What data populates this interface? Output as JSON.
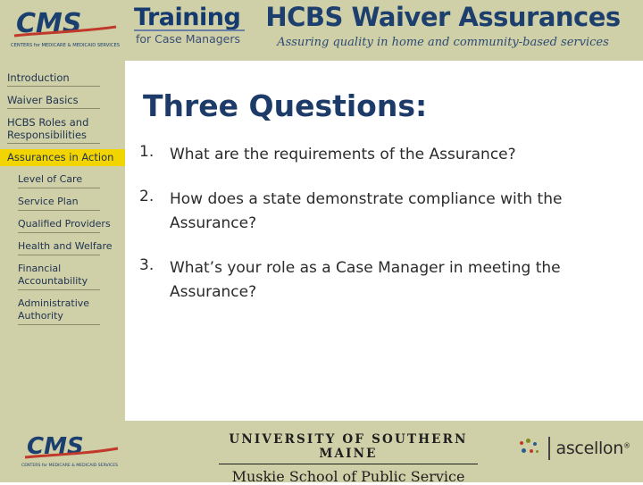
{
  "header": {
    "logo_top": "cms-logo",
    "logo_top_caption": "CENTERS for MEDICARE & MEDICAID SERVICES",
    "logo_text": "CMS",
    "training_word": "Training",
    "training_sub": "for Case Managers",
    "title": "HCBS Waiver Assurances",
    "subtitle": "Assuring quality in home and community-based services"
  },
  "sidebar": {
    "items": [
      {
        "label": "Introduction",
        "level": "top",
        "active": false
      },
      {
        "label": "Waiver Basics",
        "level": "top",
        "active": false
      },
      {
        "label": "HCBS Roles and Responsibilities",
        "level": "top",
        "active": false
      },
      {
        "label": "Assurances in Action",
        "level": "top",
        "active": true
      },
      {
        "label": "Level of Care",
        "level": "sub",
        "active": false
      },
      {
        "label": "Service Plan",
        "level": "sub",
        "active": false
      },
      {
        "label": "Qualified Providers",
        "level": "sub",
        "active": false
      },
      {
        "label": "Health and Welfare",
        "level": "sub",
        "active": false
      },
      {
        "label": "Financial Accountability",
        "level": "sub",
        "active": false
      },
      {
        "label": "Administrative Authority",
        "level": "sub",
        "active": false
      }
    ]
  },
  "main": {
    "title": "Three Questions:",
    "questions": [
      {
        "number": "1.",
        "text": "What are the requirements of the Assurance?"
      },
      {
        "number": "2.",
        "text": "How does a state demonstrate compliance with the Assurance?"
      },
      {
        "number": "3.",
        "text": "What’s your role as a Case Manager in meeting the Assurance?"
      }
    ]
  },
  "footer": {
    "cms_logo_text": "CMS",
    "cms_logo_caption": "CENTERS for MEDICARE & MEDICAID SERVICES",
    "university_line1": "UNIVERSITY OF SOUTHERN MAINE",
    "university_line2": "Muskie School of Public Service",
    "partner_name": "ascellon",
    "partner_mark": "®"
  },
  "colors": {
    "band": "#cfcfa8",
    "highlight": "#f2d400",
    "title_blue": "#1c3b68",
    "body_text": "#2b2b2b"
  }
}
